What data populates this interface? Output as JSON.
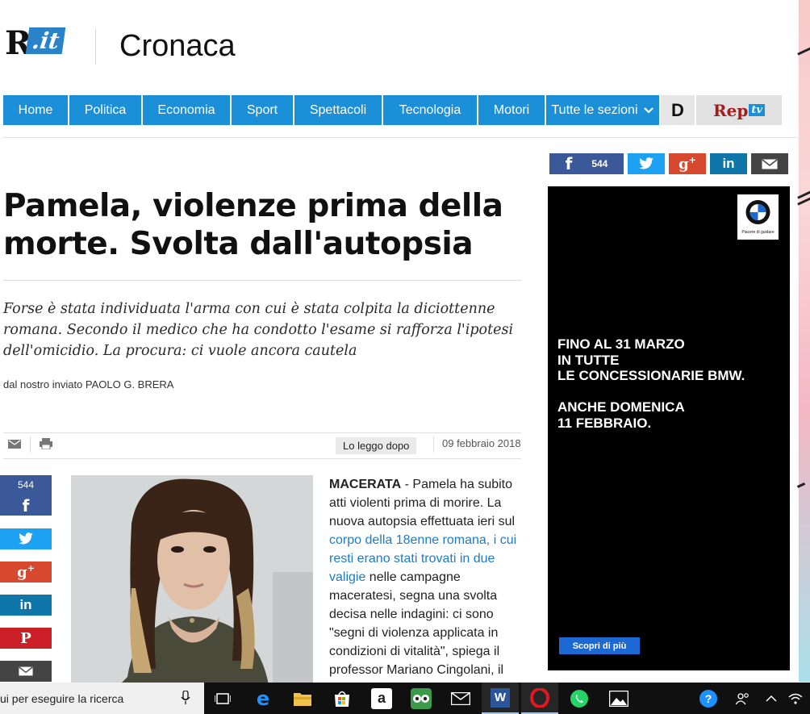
{
  "header": {
    "logo_r": "R",
    "logo_it": ".it",
    "section_title": "Cronaca"
  },
  "nav": {
    "items": [
      "Home",
      "Politica",
      "Economia",
      "Sport",
      "Spettacoli",
      "Tecnologia",
      "Motori",
      "Tutte le sezioni"
    ],
    "d_label": "D",
    "rep_label": "Rep",
    "tv_label": "tv"
  },
  "share_top": {
    "facebook_count": "544"
  },
  "article": {
    "headline": "Pamela, violenze prima della morte. Svolta dall'autopsia",
    "summary": "Forse è stata individuata l'arma con cui è stata colpita la diciottenne romana. Secondo il medico che ha condotto l'esame si rafforza l'ipotesi dell'omicidio. La procura: ci vuole ancora cautela",
    "byline": "dal nostro inviato PAOLO G. BRERA",
    "read_later": "Lo leggo dopo",
    "date": "09 febbraio 2018",
    "body_city": "MACERATA",
    "body_1": " - Pamela ha subito atti violenti prima di morire. La nuova autopsia effettuata ieri sul ",
    "body_link": "corpo della 18enne romana, i cui resti erano stati trovati in due valigie",
    "body_2": " nelle campagne maceratesi, segna una svolta decisa nelle indagini: ci sono \"segni di violenza applicata in condizioni di vitalità\", spiega il professor Mariano Cingolani, il"
  },
  "side_share": {
    "facebook_count": "544",
    "facebook_glyph": "f"
  },
  "ad": {
    "brand_tag": "Piacere di guidare",
    "text": "FINO AL 31 MARZO\nIN TUTTE\nLE CONCESSIONARIE BMW.\n\nANCHE DOMENICA\n11 FEBBRAIO.",
    "button": "Scopri di più"
  },
  "taskbar": {
    "search_text": "ui per eseguire la ricerca",
    "icons": [
      "task-view-icon",
      "edge-icon",
      "file-explorer-icon",
      "store-icon",
      "amazon-icon",
      "tripadvisor-icon",
      "mail-icon",
      "word-icon",
      "opera-icon",
      "whatsapp-icon",
      "photos-icon"
    ],
    "tray_icons": [
      "help-icon",
      "people-icon",
      "chevron-up-icon",
      "wifi-icon"
    ]
  },
  "colors": {
    "nav_blue": "#1b8fd7",
    "facebook": "#3b5998",
    "twitter": "#1da1f2",
    "google_plus": "#d6492f",
    "linkedin": "#0e76a8",
    "pinterest": "#cb2027",
    "email": "#444444",
    "link_blue": "#1b7cc4"
  }
}
